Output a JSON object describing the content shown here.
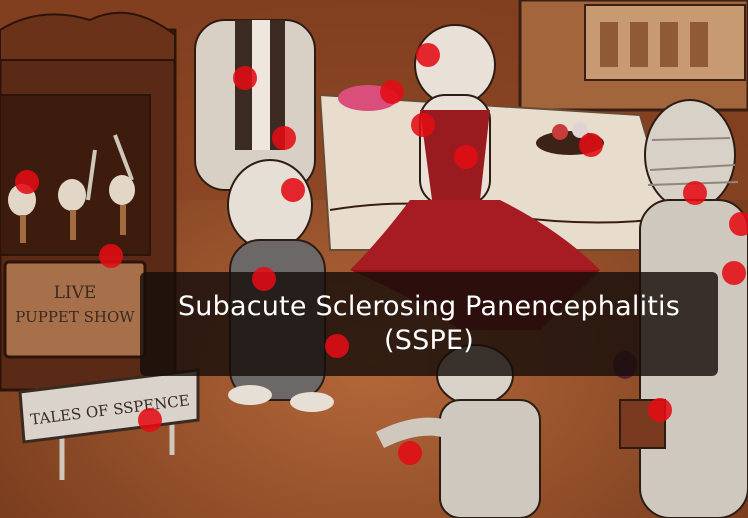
{
  "scene": {
    "puppet_sign_line1": "LIVE",
    "puppet_sign_line2": "PUPPET SHOW",
    "tales_sign": "TALES OF SSPENCE"
  },
  "caption": {
    "line1": "Subacute Sclerosing Panencephalitis",
    "line2": "(SSPE)"
  },
  "colors": {
    "hotspot": "#e20c14",
    "overlay": "#160e0a",
    "background": "#7a3f1f"
  }
}
